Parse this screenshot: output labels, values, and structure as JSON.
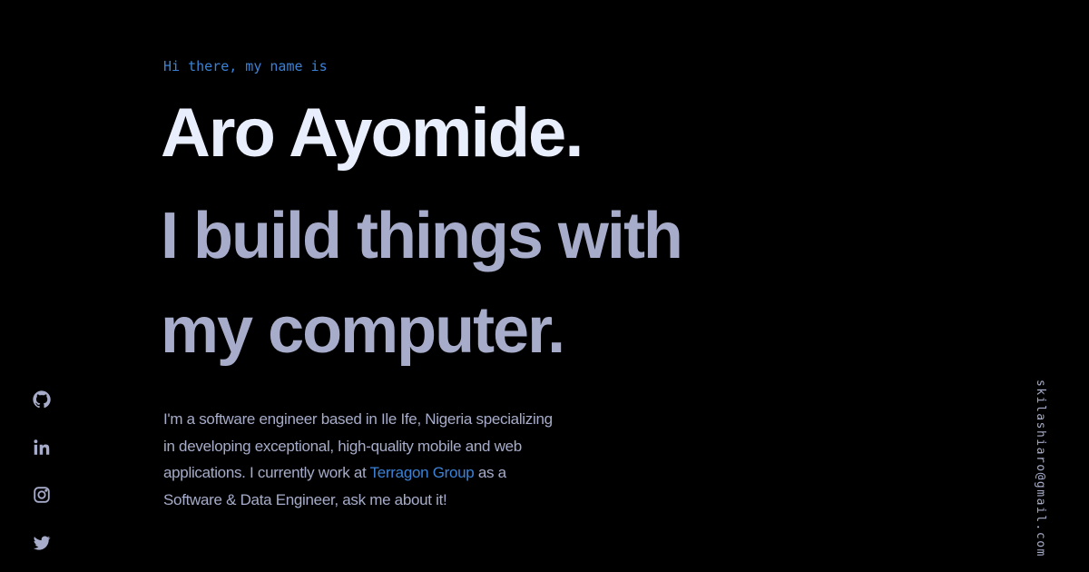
{
  "hero": {
    "greeting": "Hi there, my name is",
    "name": "Aro Ayomide.",
    "tagline": "I build things with my computer.",
    "bio": {
      "part1": "I'm a software engineer based in Ile Ife, Nigeria specializing in developing exceptional, high-quality mobile and web applications. I currently work at ",
      "company_link": "Terragon Group",
      "part2": " as a Software & Data Engineer, ask me about it!"
    }
  },
  "socials": [
    {
      "icon": "github-icon"
    },
    {
      "icon": "linkedin-icon"
    },
    {
      "icon": "instagram-icon"
    },
    {
      "icon": "twitter-icon"
    }
  ],
  "email": "skilashiaro@gmail.com",
  "colors": {
    "background": "#000000",
    "accent": "#3b82d6",
    "name": "#e8eefc",
    "muted": "#a6acc9"
  }
}
